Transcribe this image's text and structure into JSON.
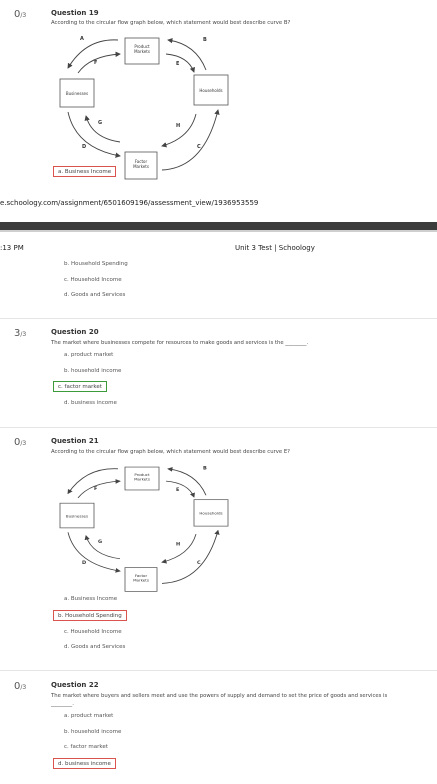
{
  "q19": {
    "score": "0",
    "score_total": "/3",
    "title": "Question 19",
    "text": "According to the circular flow graph below, which statement would best describe curve B?",
    "selected_answer": "a. Business Income"
  },
  "diagram": {
    "product_markets": [
      "Product",
      "Markets"
    ],
    "factor_markets": [
      "Factor",
      "Markets"
    ],
    "businesses": "Businesses",
    "households": "Households",
    "labels": {
      "A": "A",
      "B": "B",
      "C": "C",
      "D": "D",
      "E": "E",
      "F": "F",
      "G": "G",
      "H": "H"
    }
  },
  "browser": {
    "url": "e.schoology.com/assignment/6501609196/assessment_view/1936953559",
    "time": ":13 PM",
    "page_title": "Unit 3 Test | Schoology"
  },
  "q19_rest": {
    "options": [
      "b. Household Spending",
      "c. Household Income",
      "d. Goods and Services"
    ]
  },
  "q20": {
    "score": "3",
    "score_total": "/3",
    "title": "Question 20",
    "text": "The market where businesses compete for resources to make goods and services is the ________.",
    "options": [
      "a. product market",
      "b. household income",
      "c. factor market",
      "d. business income"
    ]
  },
  "q21": {
    "score": "0",
    "score_total": "/3",
    "title": "Question 21",
    "text": "According to the circular flow graph below, which statement would best describe curve E?",
    "options": [
      "a. Business Income",
      "b. Household Spending",
      "c. Household Income",
      "d. Goods and Services"
    ]
  },
  "q22": {
    "score": "0",
    "score_total": "/3",
    "title": "Question 22",
    "text": "The market where buyers and sellers meet and use the powers of supply and demand to set the price of goods and services is ________.",
    "options": [
      "a. product market",
      "b. household income",
      "c. factor market",
      "d. business income"
    ]
  }
}
